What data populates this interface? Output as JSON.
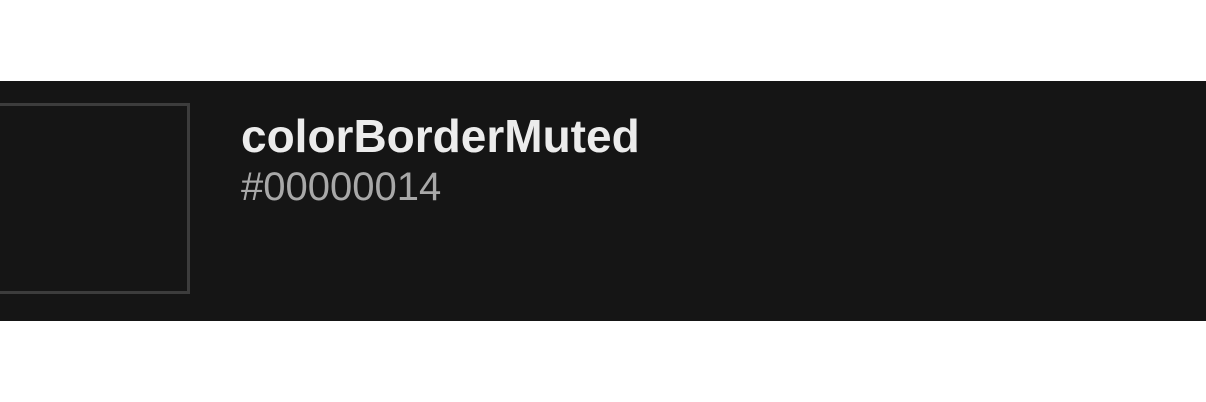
{
  "token": {
    "name": "colorBorderMuted",
    "value": "#00000014"
  },
  "colors": {
    "page_background": "#ffffff",
    "row_background": "#151515",
    "swatch_border": "#3c3c3c",
    "name_text": "#ececec",
    "value_text": "#a8a8a8"
  }
}
